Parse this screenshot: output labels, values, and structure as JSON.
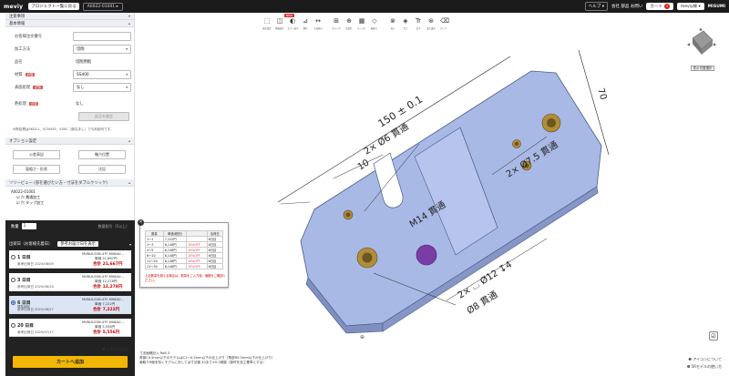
{
  "topbar": {
    "logo": "meviy",
    "back": "プロジェクト一覧に戻る",
    "project": "A0022-01001 ▸",
    "help": "ヘルプ ▾",
    "links": "会社  部品  お問い",
    "cart": "カート",
    "cart_count": "3",
    "user": "meviy様 ▾",
    "brand": "MISUMI"
  },
  "side": {
    "sections": {
      "order": "注意事項",
      "basic": "基本情報",
      "option": "オプション設定",
      "tree": "ツリービュー (部を選びたい方・寸法をダブルクリック)"
    },
    "fields": [
      {
        "label": "お客様注文番号",
        "value": ""
      },
      {
        "label": "加工方法",
        "value": "切削"
      },
      {
        "label": "品名",
        "value": "切削用板"
      },
      {
        "label": "材質",
        "value": "SS400",
        "req": "必須"
      },
      {
        "label": "表面処理",
        "value": "なし",
        "req": "必須"
      },
      {
        "label": "熱処理",
        "value": "なし",
        "req": "必須"
      }
    ],
    "confirm_button": "部品を確定",
    "note": "※熱処理はSKD11、SCM435、S50C（焼なまし）でも利用可です。",
    "option_buttons": [
      "公差表記",
      "軸穴位置",
      "面粗さ・形状",
      "注記"
    ],
    "tree_items": [
      "A0022-01001",
      "☑ 穴 貫通加工",
      "  ☑ 穴 タップ加工"
    ]
  },
  "dark": {
    "qty_label": "数量",
    "qty": "1",
    "next_label": "数量割引（1以上）",
    "days_header": "出荷日（お客様先着日）",
    "days_button": "参考お届け日を表示",
    "quotes": [
      {
        "day": "1 日目",
        "code": "MVBLK-SSN-47F-M06AU…",
        "unit": "単価 21,667円",
        "total": "合計 21,667円",
        "ship": "参考出荷日 2025/06/09",
        "note": ""
      },
      {
        "day": "3 日目",
        "code": "MVBLK-SSN-47F-M06AU…",
        "unit": "単価 12,278円",
        "total": "合計 12,278円",
        "ship": "参考出荷日 2025/06/24",
        "note": ""
      },
      {
        "day": "6 日目",
        "code": "MVBLK-SSN-47F-M06AU…",
        "unit": "単価 7,222円",
        "total": "合計 7,222円",
        "ship": "参考出荷日 2025/06/27",
        "note": "標準納期"
      },
      {
        "day": "20 日目",
        "code": "MVBLK-SSN-47F-M06AU…",
        "unit": "単価 5,556円",
        "total": "合計 5,556円",
        "ship": "参考出荷日 2025/07/17",
        "note": ""
      }
    ],
    "link": "❶ 出荷日の指定",
    "cart_button": "カートへ追加"
  },
  "toolbar": {
    "new_tag": "NEW",
    "tools": [
      {
        "icon": "cube-icon",
        "glyph": "⬚",
        "label": "表示設定"
      },
      {
        "icon": "section-icon",
        "glyph": "◫",
        "label": "断面表示"
      },
      {
        "icon": "color-icon",
        "glyph": "◐",
        "label": "カラー表示"
      },
      {
        "icon": "measure-icon",
        "glyph": "⊿",
        "label": "測定"
      },
      {
        "icon": "dimension-icon",
        "glyph": "↔",
        "label": "寸法表示"
      },
      {
        "icon": "group-icon",
        "glyph": "⊞",
        "label": "グループ"
      },
      {
        "icon": "hole-icon",
        "glyph": "⊕",
        "label": "穴設定"
      },
      {
        "icon": "table-icon",
        "glyph": "▦",
        "label": "テーブル"
      },
      {
        "icon": "chamfer-icon",
        "glyph": "◇",
        "label": "面取り"
      },
      {
        "icon": "thread-icon",
        "glyph": "⊗",
        "label": "ねじ"
      },
      {
        "icon": "finish-icon",
        "glyph": "◈",
        "label": "仕上"
      },
      {
        "icon": "text-icon",
        "glyph": "Tr",
        "label": "文字"
      },
      {
        "icon": "feature-icon",
        "glyph": "⊛",
        "label": "加工設定"
      },
      {
        "icon": "clear-icon",
        "glyph": "⌫",
        "label": "クリア"
      }
    ]
  },
  "popup": {
    "headers": [
      "数量",
      "単価(税別)",
      "",
      "出荷日"
    ],
    "rows": [
      [
        "1〜1",
        "7,222円",
        "",
        "6日目"
      ],
      [
        "2〜3",
        "6,148円",
        "15%OFF",
        "6日目"
      ],
      [
        "4〜5",
        "6,148円",
        "15%OFF",
        "6日目"
      ],
      [
        "6〜10",
        "6,148円",
        "15%OFF",
        "6日目"
      ],
      [
        "11〜20",
        "6,148円",
        "15%OFF",
        "6日目"
      ],
      [
        "21〜30",
        "6,148円",
        "15%OFF",
        "6日目"
      ]
    ],
    "warning": "上記数量を超える場合は、数量をご入力後、価格をご確認ください。"
  },
  "drawing": {
    "dims": [
      "150 ± 0.1",
      "2× Ø6 貫通",
      "70",
      "2× Ø7.5 貫通",
      "10",
      "M14 貫通",
      "2× ⌴ Ø12 ↧4",
      "Ø8 貫通"
    ],
    "plate_color": "#a9b9e6",
    "bore_color": "#b08d3a",
    "purple_color": "#7a3da6"
  },
  "footnote": [
    "寸法面積記入 Ra6.3",
    "角部C0.5mm以下のモデルはC1〜0.5mm以下の仕上げり（角部R0.5mm以下の仕上げり）",
    "面取りR面を除くモデルに対しては寸法値 20まで±0.1精度（部材を加工基準とする）"
  ],
  "right": {
    "view_button": "表示切替選択",
    "bottom1": "❶ アイコンについて",
    "bottom2": "❷ 5Rモデルの使い方"
  }
}
